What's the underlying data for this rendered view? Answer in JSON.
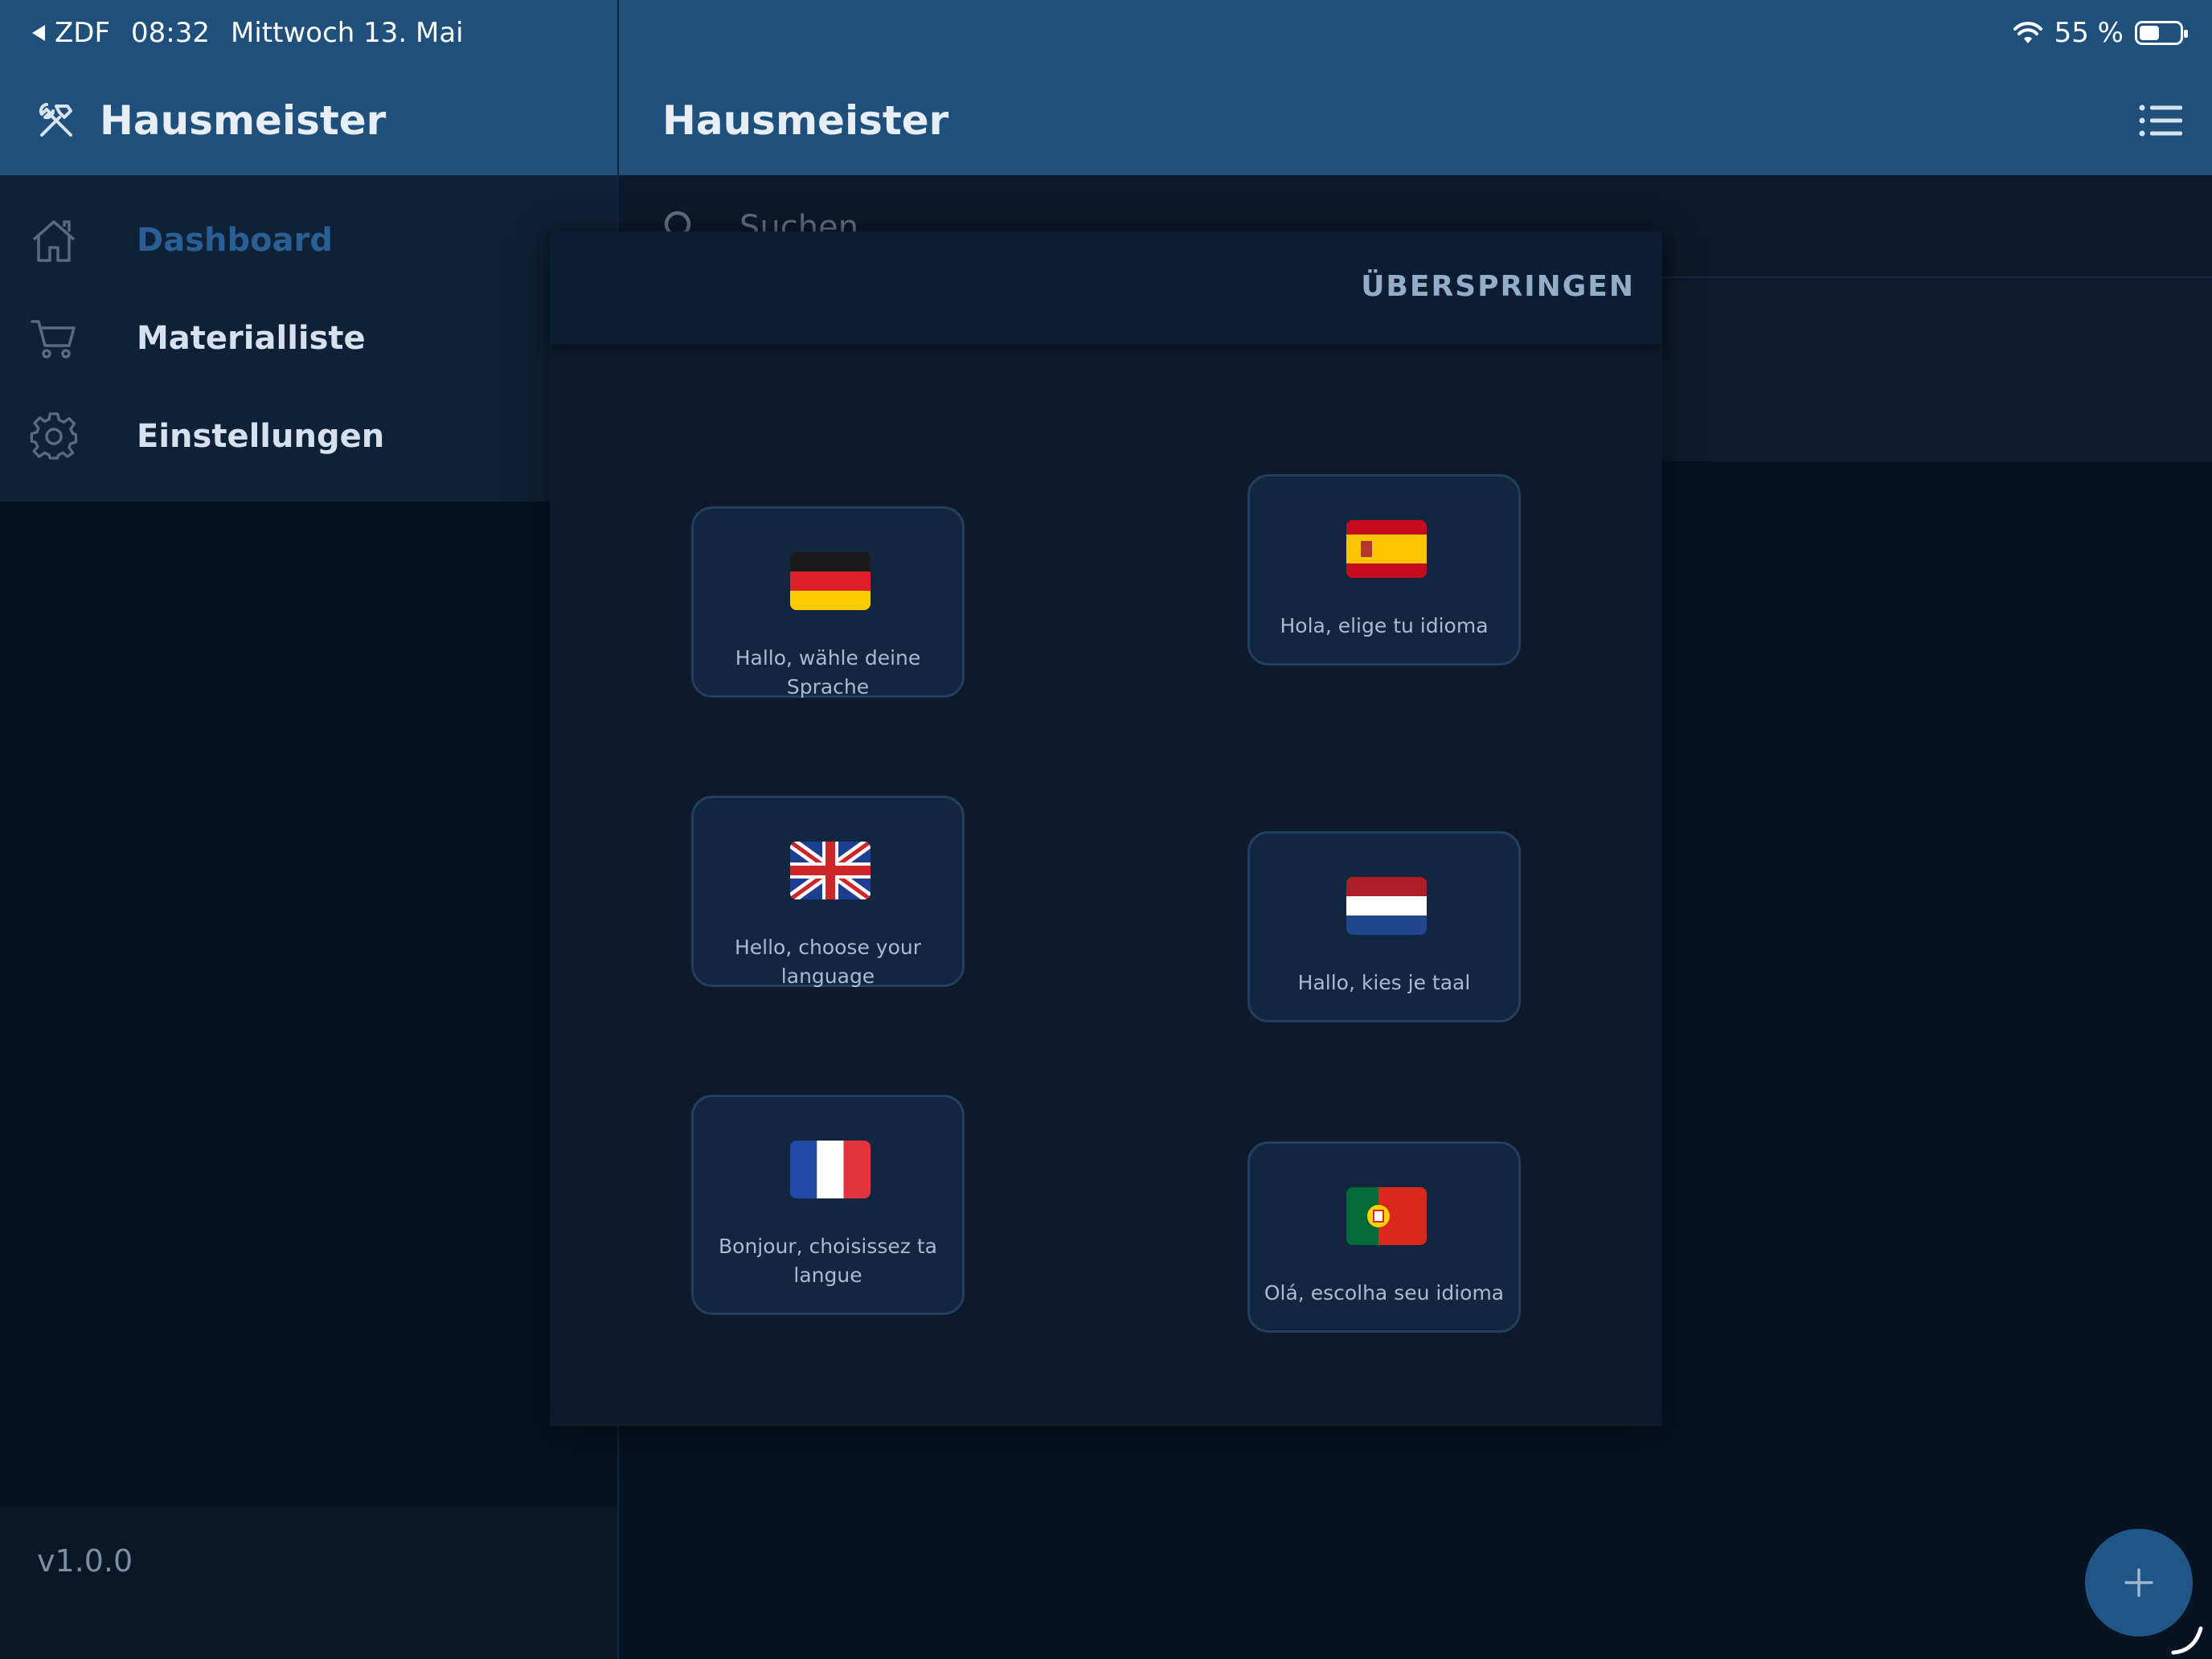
{
  "status_bar": {
    "back_app": "ZDF",
    "time": "08:32",
    "date": "Mittwoch 13. Mai",
    "battery": "55 %"
  },
  "sidebar": {
    "title": "Hausmeister",
    "items": [
      {
        "label": "Dashboard",
        "icon": "home-icon",
        "active": true
      },
      {
        "label": "Materialliste",
        "icon": "cart-icon",
        "active": false
      },
      {
        "label": "Einstellungen",
        "icon": "gear-icon",
        "active": false
      }
    ],
    "version": "v1.0.0"
  },
  "main": {
    "title": "Hausmeister",
    "search_placeholder": "Suchen"
  },
  "modal": {
    "skip_label": "ÜBERSPRINGEN",
    "languages": [
      {
        "label": "Hallo, wähle deine Sprache",
        "flag": "germany-flag-icon"
      },
      {
        "label": "Hola, elige tu idioma",
        "flag": "spain-flag-icon"
      },
      {
        "label": "Hello, choose your language",
        "flag": "uk-flag-icon"
      },
      {
        "label": "Hallo, kies je taal",
        "flag": "netherlands-flag-icon"
      },
      {
        "label": "Bonjour, choisissez ta langue",
        "flag": "france-flag-icon"
      },
      {
        "label": "Olá, escolha seu idioma",
        "flag": "portugal-flag-icon"
      }
    ]
  },
  "colors": {
    "topbar": "#1f4f7b",
    "accent": "#295f94",
    "background": "#081321",
    "card": "#132640"
  }
}
